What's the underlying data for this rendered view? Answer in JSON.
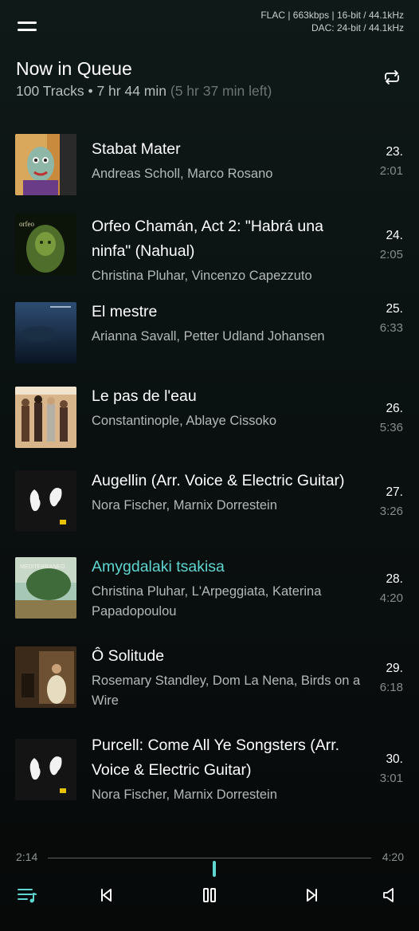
{
  "audio": {
    "source": "FLAC | 663kbps | 16-bit / 44.1kHz",
    "dac": "DAC: 24-bit / 44.1kHz"
  },
  "queue": {
    "title": "Now in Queue",
    "summary": "100 Tracks • 7 hr 44 min",
    "time_left": "(5 hr 37 min left)"
  },
  "tracks": [
    {
      "title": "Stabat Mater",
      "artist": "Andreas Scholl, Marco Rosano",
      "index": "23.",
      "duration": "2:01",
      "active": false
    },
    {
      "title": "Orfeo Chamán, Act 2: \"Habrá una ninfa\" (Nahual)",
      "artist": "Christina Pluhar, Vincenzo Capezzuto",
      "index": "24.",
      "duration": "2:05",
      "active": false
    },
    {
      "title": "El mestre",
      "artist": "Arianna Savall, Petter Udland Johansen",
      "index": "25.",
      "duration": "6:33",
      "active": false
    },
    {
      "title": "Le pas de l'eau",
      "artist": "Constantinople, Ablaye Cissoko",
      "index": "26.",
      "duration": "5:36",
      "active": false
    },
    {
      "title": "Augellin (Arr. Voice & Electric Guitar)",
      "artist": "Nora Fischer, Marnix Dorrestein",
      "index": "27.",
      "duration": "3:26",
      "active": false
    },
    {
      "title": "Amygdalaki tsakisa",
      "artist": "Christina Pluhar, L'Arpeggiata, Katerina Papadopoulou",
      "index": "28.",
      "duration": "4:20",
      "active": true
    },
    {
      "title": "Ô Solitude",
      "artist": "Rosemary Standley, Dom La Nena, Birds on a Wire",
      "index": "29.",
      "duration": "6:18",
      "active": false
    },
    {
      "title": "Purcell: Come All Ye Songsters (Arr. Voice & Electric Guitar)",
      "artist": "Nora Fischer, Marnix Dorrestein",
      "index": "30.",
      "duration": "3:01",
      "active": false
    }
  ],
  "player": {
    "elapsed": "2:14",
    "total": "4:20",
    "progress": 0.515
  },
  "colors": {
    "accent": "#5fd6d0",
    "background": "#0b1212"
  },
  "icons": [
    "menu-icon",
    "repeat-icon",
    "queue-icon",
    "skip-previous-icon",
    "pause-icon",
    "skip-next-icon",
    "volume-icon"
  ]
}
